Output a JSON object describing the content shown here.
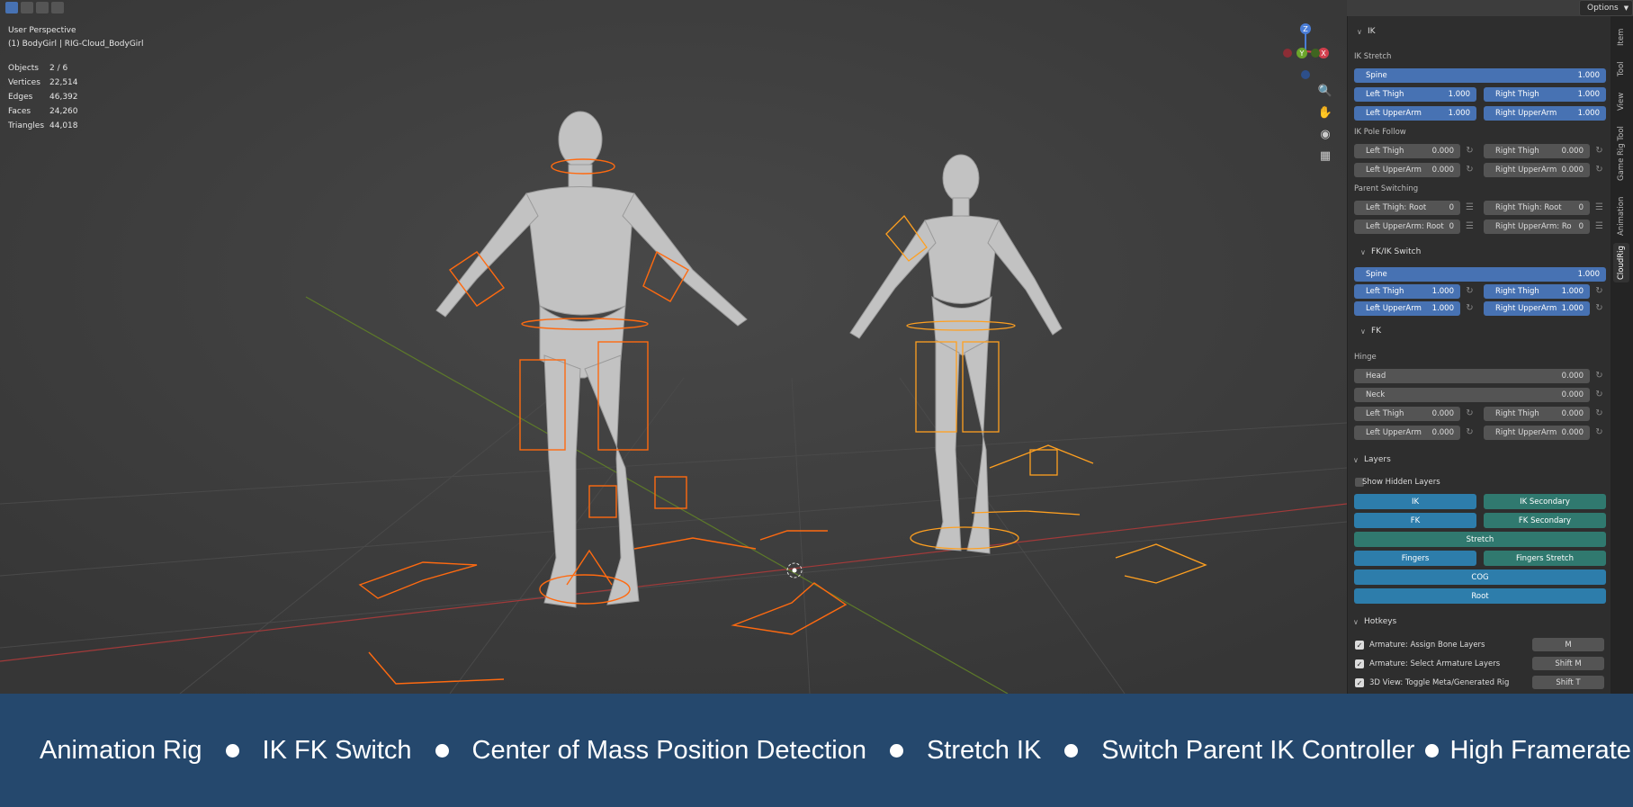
{
  "viewport": {
    "perspective": "User Perspective",
    "object": "(1) BodyGirl | RIG-Cloud_BodyGirl",
    "options_label": "Options",
    "stats": [
      {
        "label": "Objects",
        "value": "2 / 6"
      },
      {
        "label": "Vertices",
        "value": "22,514"
      },
      {
        "label": "Edges",
        "value": "46,392"
      },
      {
        "label": "Faces",
        "value": "24,260"
      },
      {
        "label": "Triangles",
        "value": "44,018"
      }
    ],
    "gizmo": {
      "z": "Z",
      "y": "Y",
      "x": "X"
    }
  },
  "tabs": [
    "Item",
    "Tool",
    "View",
    "Game Rig Tool",
    "Animation",
    "CloudRig"
  ],
  "panel": {
    "ik": {
      "title": "IK",
      "stretch_label": "IK Stretch",
      "spine": {
        "label": "Spine",
        "value": "1.000"
      },
      "left_thigh": {
        "label": "Left Thigh",
        "value": "1.000"
      },
      "right_thigh": {
        "label": "Right Thigh",
        "value": "1.000"
      },
      "left_upperarm": {
        "label": "Left UpperArm",
        "value": "1.000"
      },
      "right_upperarm": {
        "label": "Right UpperArm",
        "value": "1.000"
      },
      "pole_label": "IK Pole Follow",
      "pole_left_thigh": {
        "label": "Left Thigh",
        "value": "0.000"
      },
      "pole_right_thigh": {
        "label": "Right Thigh",
        "value": "0.000"
      },
      "pole_left_upperarm": {
        "label": "Left UpperArm",
        "value": "0.000"
      },
      "pole_right_upperarm": {
        "label": "Right UpperArm",
        "value": "0.000"
      },
      "parent_label": "Parent Switching",
      "ps_left_thigh": {
        "label": "Left Thigh: Root",
        "value": "0"
      },
      "ps_right_thigh": {
        "label": "Right Thigh: Root",
        "value": "0"
      },
      "ps_left_upperarm": {
        "label": "Left UpperArm: Root",
        "value": "0"
      },
      "ps_right_upperarm": {
        "label": "Right UpperArm: Ro",
        "value": "0"
      }
    },
    "fkik": {
      "title": "FK/IK Switch",
      "spine": {
        "label": "Spine",
        "value": "1.000"
      },
      "left_thigh": {
        "label": "Left Thigh",
        "value": "1.000"
      },
      "right_thigh": {
        "label": "Right Thigh",
        "value": "1.000"
      },
      "left_upperarm": {
        "label": "Left UpperArm",
        "value": "1.000"
      },
      "right_upperarm": {
        "label": "Right UpperArm",
        "value": "1.000"
      }
    },
    "fk": {
      "title": "FK",
      "hinge_label": "Hinge",
      "head": {
        "label": "Head",
        "value": "0.000"
      },
      "neck": {
        "label": "Neck",
        "value": "0.000"
      },
      "left_thigh": {
        "label": "Left Thigh",
        "value": "0.000"
      },
      "right_thigh": {
        "label": "Right Thigh",
        "value": "0.000"
      },
      "left_upperarm": {
        "label": "Left UpperArm",
        "value": "0.000"
      },
      "right_upperarm": {
        "label": "Right UpperArm",
        "value": "0.000"
      }
    },
    "layers": {
      "title": "Layers",
      "show_hidden": "Show Hidden Layers",
      "ik": "IK",
      "ik_secondary": "IK Secondary",
      "fk": "FK",
      "fk_secondary": "FK Secondary",
      "stretch": "Stretch",
      "fingers": "Fingers",
      "fingers_stretch": "Fingers Stretch",
      "cog": "COG",
      "root": "Root"
    },
    "hotkeys": {
      "title": "Hotkeys",
      "items": [
        {
          "label": "Armature: Assign Bone Layers",
          "key": "M"
        },
        {
          "label": "Armature: Select Armature Layers",
          "key": "Shift M"
        },
        {
          "label": "3D View: Toggle Meta/Generated Rig",
          "key": "Shift T"
        }
      ]
    }
  },
  "banner": {
    "items": [
      "Animation Rig",
      "IK FK Switch",
      "Center of Mass Position Detection",
      "Stretch IK",
      "Switch Parent IK Controller",
      "High Framerate"
    ]
  },
  "colors": {
    "accent_blue": "#4772b3",
    "layer_blue": "#2d7dab",
    "layer_teal": "#30796f",
    "rig_orange": "#ff7a1a",
    "banner": "#25486d"
  }
}
